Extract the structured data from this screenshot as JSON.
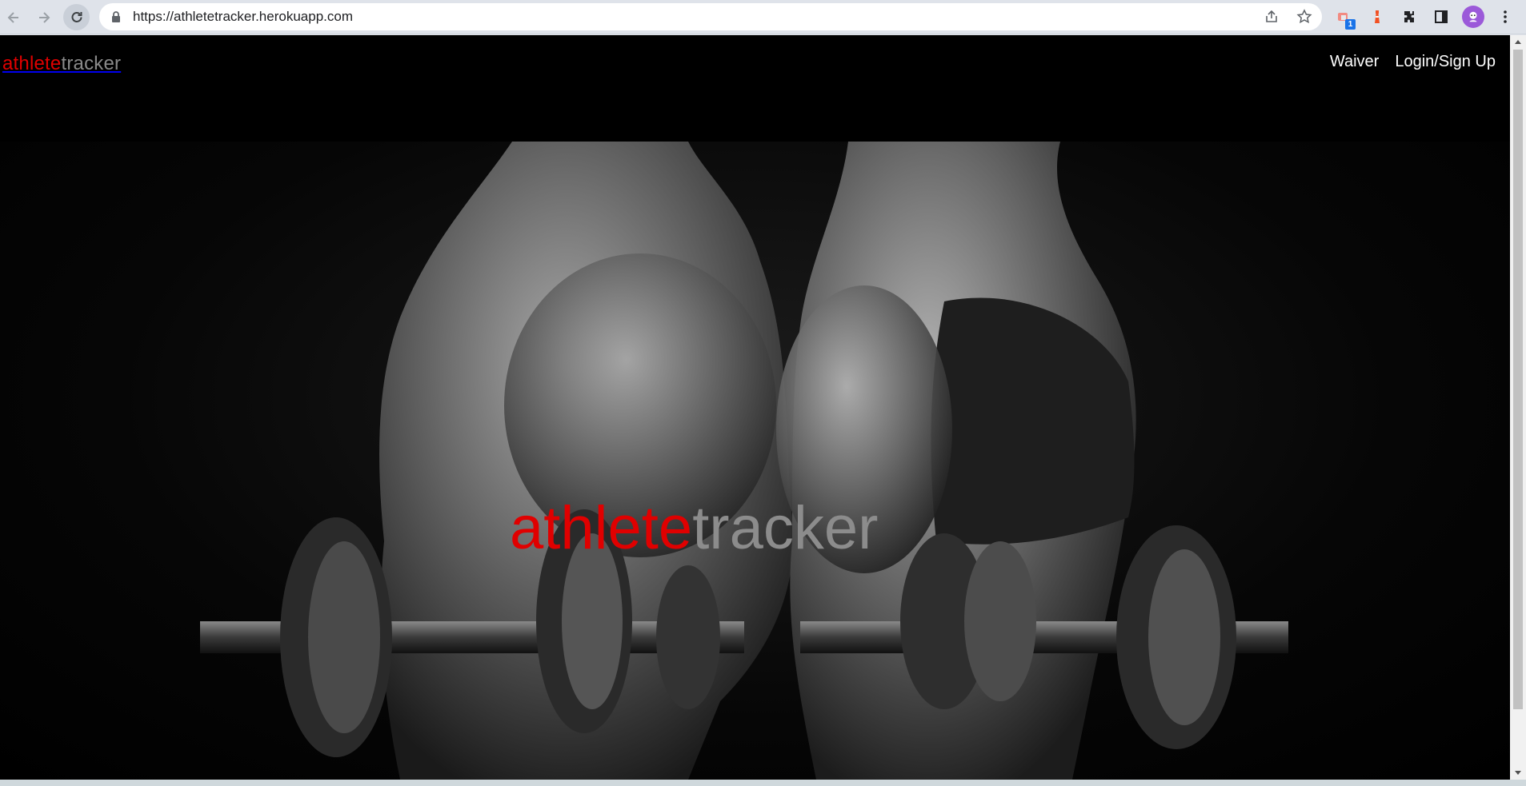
{
  "browser": {
    "url": "https://athletetracker.herokuapp.com",
    "extension_badge": "1",
    "icons": [
      "back-icon",
      "forward-icon",
      "reload-icon",
      "lock-icon",
      "share-icon",
      "star-icon",
      "extension-icon",
      "puzzle-icon",
      "side-panel-icon",
      "menu-icon"
    ]
  },
  "navbar": {
    "brand_first": "athlete",
    "brand_second": "tracker",
    "links": [
      {
        "label": "Waiver"
      },
      {
        "label": "Login/Sign Up"
      }
    ]
  },
  "hero": {
    "title_first": "athlete",
    "title_second": "tracker",
    "image": "black-and-white photo of a man and woman holding dumbbells"
  },
  "colors": {
    "accent_red": "#e00000",
    "muted_grey": "#8a8a8a",
    "background": "#000000"
  }
}
